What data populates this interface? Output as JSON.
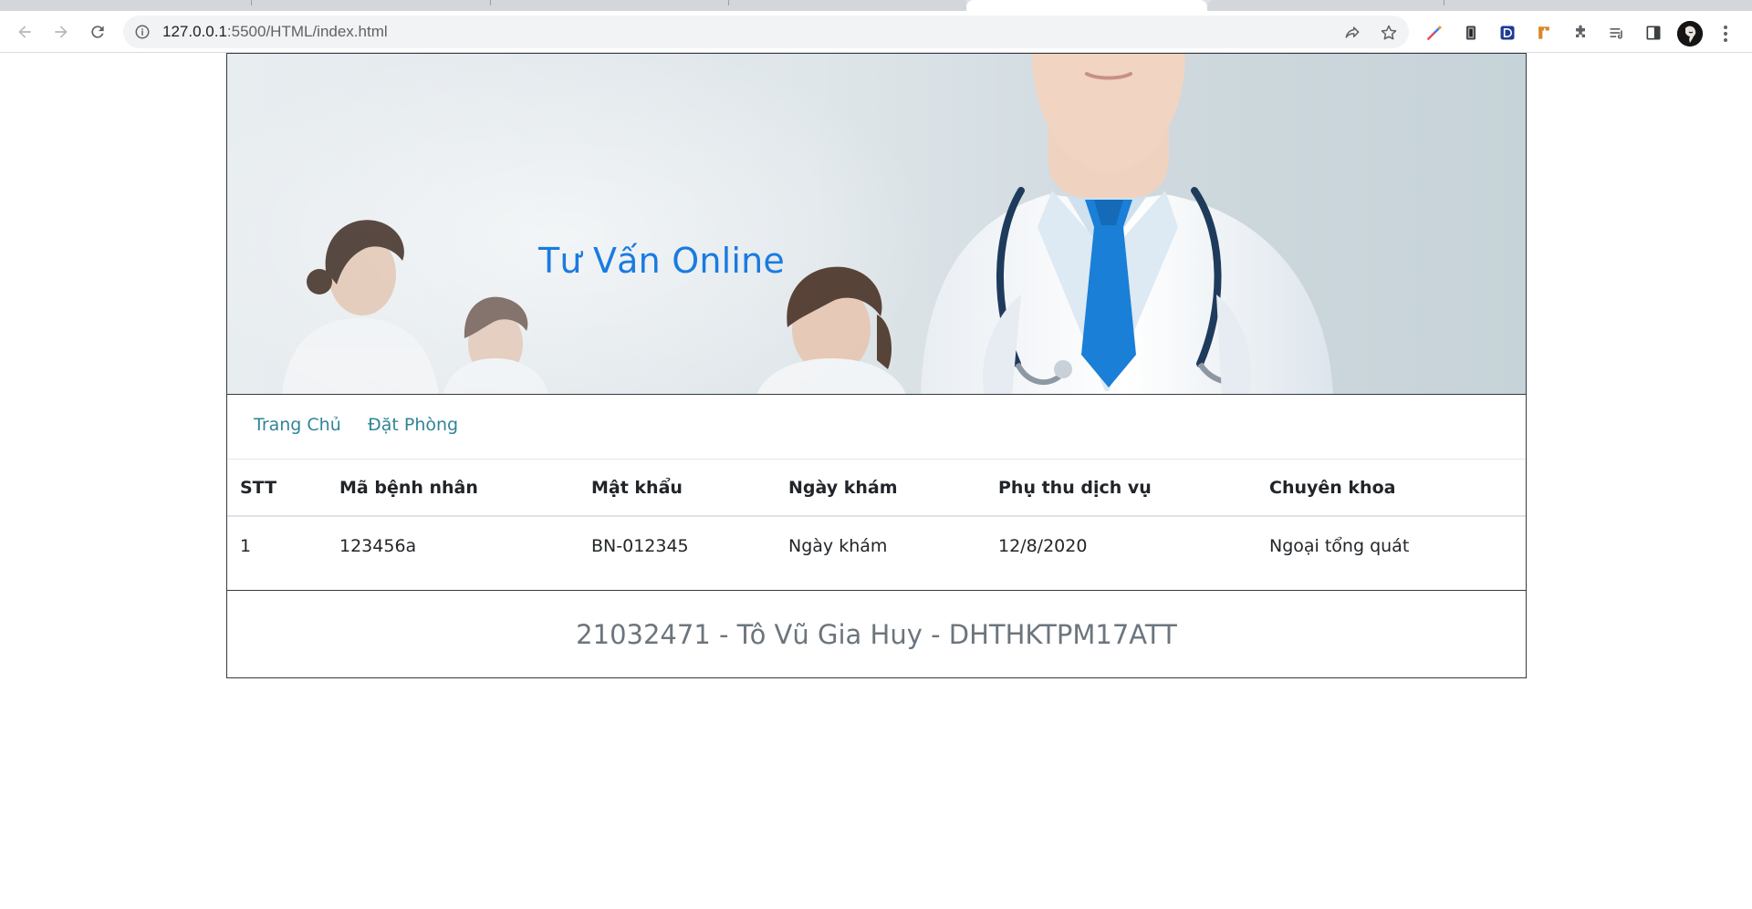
{
  "browser": {
    "url_host": "127.0.0.1",
    "url_path": ":5500/HTML/index.html"
  },
  "header": {
    "title": "Tư Vấn Online"
  },
  "nav": {
    "items": [
      {
        "label": "Trang Chủ"
      },
      {
        "label": "Đặt Phòng"
      }
    ]
  },
  "table": {
    "columns": [
      "STT",
      "Mã bệnh nhân",
      "Mật khẩu",
      "Ngày khám",
      "Phụ thu dịch vụ",
      "Chuyên khoa"
    ],
    "rows": [
      [
        "1",
        "123456a",
        "BN-012345",
        "Ngày khám",
        "12/8/2020",
        "Ngoại tổng quát"
      ]
    ]
  },
  "footer": {
    "text": "21032471 - Tô Vũ Gia Huy - DHTHKTPM17ATT"
  },
  "colors": {
    "title_blue": "#1a7be0",
    "nav_link": "#2f8596",
    "footer_gray": "#6c757d"
  },
  "icons": [
    "back-icon",
    "forward-icon",
    "reload-icon",
    "info-icon",
    "share-icon",
    "star-icon",
    "color-picker-icon",
    "extension-icon",
    "puzzle-icon",
    "reading-list-icon",
    "side-panel-icon",
    "avatar",
    "menu-icon"
  ]
}
